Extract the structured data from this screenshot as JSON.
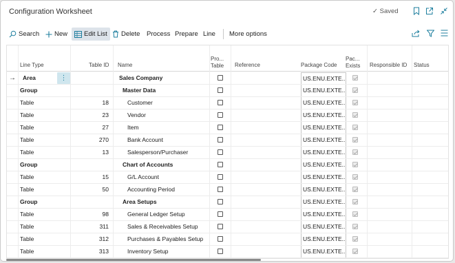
{
  "window": {
    "title": "Configuration Worksheet",
    "saved_status": "Saved"
  },
  "actions": {
    "search": "Search",
    "new": "New",
    "edit_list": "Edit List",
    "delete": "Delete",
    "process": "Process",
    "prepare": "Prepare",
    "line": "Line",
    "more_options": "More options"
  },
  "columns": {
    "line_type": "Line Type",
    "table_id": "Table ID",
    "name": "Name",
    "promoted_table_1": "Pro...",
    "promoted_table_2": "Table",
    "reference": "Reference",
    "package_code": "Package Code",
    "package_exists_1": "Pac...",
    "package_exists_2": "Exists",
    "responsible_id": "Responsible ID",
    "status": "Status"
  },
  "rows": [
    {
      "line_type": "Area",
      "table_id": "",
      "name": "Sales Company",
      "package_code": "US.ENU.EXTE...",
      "selected": true
    },
    {
      "line_type": "Group",
      "table_id": "",
      "name": "Master Data",
      "package_code": "US.ENU.EXTE..."
    },
    {
      "line_type": "Table",
      "table_id": "18",
      "name": "Customer",
      "package_code": "US.ENU.EXTE..."
    },
    {
      "line_type": "Table",
      "table_id": "23",
      "name": "Vendor",
      "package_code": "US.ENU.EXTE..."
    },
    {
      "line_type": "Table",
      "table_id": "27",
      "name": "Item",
      "package_code": "US.ENU.EXTE..."
    },
    {
      "line_type": "Table",
      "table_id": "270",
      "name": "Bank Account",
      "package_code": "US.ENU.EXTE..."
    },
    {
      "line_type": "Table",
      "table_id": "13",
      "name": "Salesperson/Purchaser",
      "package_code": "US.ENU.EXTE..."
    },
    {
      "line_type": "Group",
      "table_id": "",
      "name": "Chart of Accounts",
      "package_code": "US.ENU.EXTE..."
    },
    {
      "line_type": "Table",
      "table_id": "15",
      "name": "G/L Account",
      "package_code": "US.ENU.EXTE..."
    },
    {
      "line_type": "Table",
      "table_id": "50",
      "name": "Accounting Period",
      "package_code": "US.ENU.EXTE..."
    },
    {
      "line_type": "Group",
      "table_id": "",
      "name": "Area Setups",
      "package_code": "US.ENU.EXTE..."
    },
    {
      "line_type": "Table",
      "table_id": "98",
      "name": "General Ledger Setup",
      "package_code": "US.ENU.EXTE..."
    },
    {
      "line_type": "Table",
      "table_id": "311",
      "name": "Sales & Receivables Setup",
      "package_code": "US.ENU.EXTE..."
    },
    {
      "line_type": "Table",
      "table_id": "312",
      "name": "Purchases & Payables Setup",
      "package_code": "US.ENU.EXTE..."
    },
    {
      "line_type": "Table",
      "table_id": "313",
      "name": "Inventory Setup",
      "package_code": "US.ENU.EXTE..."
    }
  ],
  "colors": {
    "accent": "#1c7e9e",
    "selection": "#cfe6ee",
    "edit_list_bg": "#dde3ea"
  }
}
